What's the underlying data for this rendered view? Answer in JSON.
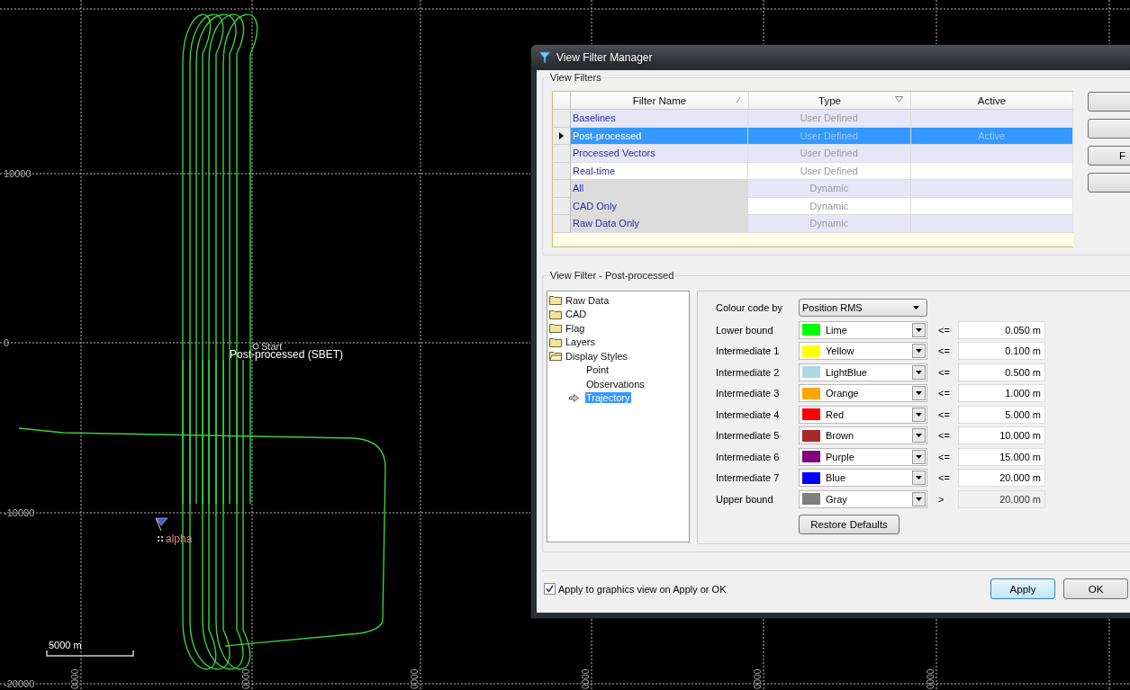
{
  "map": {
    "y_labels": [
      "10000",
      "0",
      "-10000",
      "-20000"
    ],
    "x_labels": [
      "0000",
      "0000",
      "0000",
      "0000",
      "0000",
      "0000"
    ],
    "start_label": "Start",
    "trajectory_label": "Post-processed (SBET)",
    "point_label": "alpha",
    "scale_label": "5000 m"
  },
  "dialog": {
    "title": "View Filter Manager",
    "filters_group": "View Filters",
    "columns": [
      "Filter Name",
      "Type",
      "Active"
    ],
    "rows": [
      {
        "name": "Baselines",
        "type": "User Defined",
        "kind": "user",
        "selected": false
      },
      {
        "name": "Post-processed",
        "type": "User Defined",
        "selected": true,
        "active_text": "Active"
      },
      {
        "name": "Processed Vectors",
        "type": "User Defined",
        "kind": "user",
        "selected": false
      },
      {
        "name": "Real-time",
        "type": "User Defined",
        "kind": "plain",
        "selected": false
      },
      {
        "name": "All",
        "type": "Dynamic",
        "kind": "dynamic",
        "selected": false
      },
      {
        "name": "CAD Only",
        "type": "Dynamic",
        "kind": "dynamic-plain",
        "selected": false
      },
      {
        "name": "Raw Data Only",
        "type": "Dynamic",
        "kind": "dynamic",
        "selected": false
      }
    ],
    "side_button_label": "F",
    "filter_group": "View Filter - Post-processed",
    "tree": [
      {
        "label": "Raw Data",
        "kind": "folder",
        "expanded": false,
        "selected": false
      },
      {
        "label": "CAD",
        "kind": "folder",
        "expanded": false,
        "selected": false
      },
      {
        "label": "Flag",
        "kind": "folder",
        "expanded": false,
        "selected": false
      },
      {
        "label": "Layers",
        "kind": "folder",
        "expanded": false,
        "selected": false
      },
      {
        "label": "Display Styles",
        "kind": "folder",
        "expanded": true,
        "selected": false,
        "children": [
          {
            "label": "Point",
            "selected": false
          },
          {
            "label": "Observations",
            "selected": false
          },
          {
            "label": "Trajectory",
            "selected": true
          }
        ]
      }
    ],
    "colour_code": {
      "label": "Colour code by",
      "value": "Position RMS"
    },
    "bounds": [
      {
        "label": "Lower bound",
        "color_name": "Lime",
        "color": "#00ff00",
        "operator": "<=",
        "value": "0.050 m",
        "disabled": false
      },
      {
        "label": "Intermediate 1",
        "color_name": "Yellow",
        "color": "#ffff00",
        "operator": "<=",
        "value": "0.100 m",
        "disabled": false
      },
      {
        "label": "Intermediate 2",
        "color_name": "LightBlue",
        "color": "#add8e6",
        "operator": "<=",
        "value": "0.500 m",
        "disabled": false
      },
      {
        "label": "Intermediate 3",
        "color_name": "Orange",
        "color": "#ffa500",
        "operator": "<=",
        "value": "1.000 m",
        "disabled": false
      },
      {
        "label": "Intermediate 4",
        "color_name": "Red",
        "color": "#ff0000",
        "operator": "<=",
        "value": "5.000 m",
        "disabled": false
      },
      {
        "label": "Intermediate 5",
        "color_name": "Brown",
        "color": "#a52a2a",
        "operator": "<=",
        "value": "10.000 m",
        "disabled": false
      },
      {
        "label": "Intermediate 6",
        "color_name": "Purple",
        "color": "#800080",
        "operator": "<=",
        "value": "15.000 m",
        "disabled": false
      },
      {
        "label": "Intermediate 7",
        "color_name": "Blue",
        "color": "#0000ff",
        "operator": "<=",
        "value": "20.000 m",
        "disabled": false
      },
      {
        "label": "Upper bound",
        "color_name": "Gray",
        "color": "#808080",
        "operator": ">",
        "value": "20.000 m",
        "disabled": true
      }
    ],
    "restore_button": "Restore Defaults",
    "apply_checkbox": {
      "label": "Apply to graphics view on Apply or OK",
      "checked": true
    },
    "buttons": [
      {
        "label": "Apply",
        "default": true
      },
      {
        "label": "OK",
        "default": false
      }
    ]
  }
}
